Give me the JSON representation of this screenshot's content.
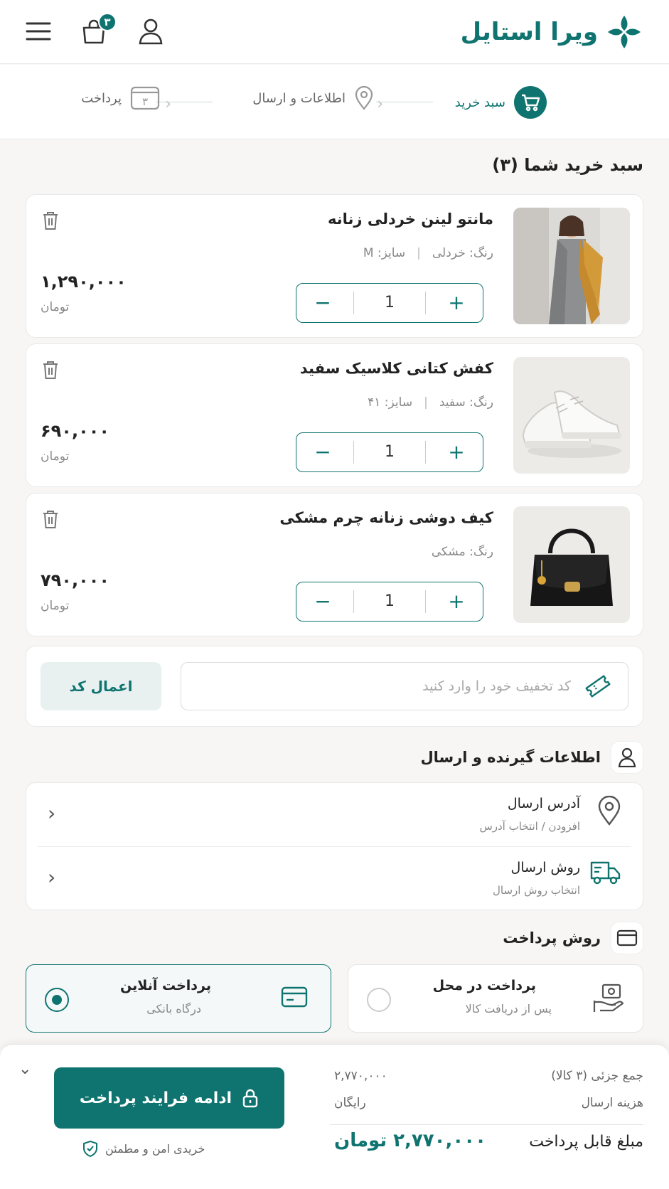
{
  "header": {
    "brand": "ویرا استایل",
    "cart_count": "۳",
    "accent": "#0f7470"
  },
  "steps": [
    {
      "label": "سبد خرید",
      "icon": "cart-icon",
      "state": "active"
    },
    {
      "label": "اطلاعات و ارسال",
      "icon": "location-pin-icon",
      "state": "pending"
    },
    {
      "label": "پرداخت",
      "icon": "payment-card-icon",
      "state": "pending",
      "number": "۳"
    }
  ],
  "cart": {
    "title": "سبد خرید شما (۳)",
    "items": [
      {
        "name": "مانتو لینن خردلی زنانه",
        "color": "رنگ: خردلی",
        "size": "سایز: M",
        "qty": "1",
        "price": "۱,۲۹۰,۰۰۰",
        "currency": "تومان"
      },
      {
        "name": "کفش کتانی کلاسیک سفید",
        "color": "رنگ: سفید",
        "size": "سایز: ۴۱",
        "qty": "1",
        "price": "۶۹۰,۰۰۰",
        "currency": "تومان"
      },
      {
        "name": "کیف دوشی زنانه چرم مشکی",
        "color": "رنگ: مشکی",
        "size": "",
        "qty": "1",
        "price": "۷۹۰,۰۰۰",
        "currency": "تومان"
      }
    ]
  },
  "coupon": {
    "placeholder": "کد تخفیف خود را وارد کنید",
    "apply_label": "اعمال کد"
  },
  "receiver": {
    "title": "اطلاعات گیرنده و ارسال",
    "address_title": "آدرس ارسال",
    "address_sub": "افزودن / انتخاب آدرس",
    "shipping_title": "روش ارسال",
    "shipping_sub": "انتخاب روش ارسال"
  },
  "payment": {
    "title": "روش پرداخت",
    "options": [
      {
        "title": "پرداخت آنلاین",
        "sub": "درگاه بانکی",
        "selected": true
      },
      {
        "title": "پرداخت در محل",
        "sub": "پس از دریافت کالا",
        "selected": false
      }
    ]
  },
  "summary": {
    "subtotal_label": "جمع جزئی (۳ کالا)",
    "subtotal_value": "۲,۷۷۰,۰۰۰",
    "shipping_label": "هزینه ارسال",
    "shipping_value": "رایگان",
    "total_label": "مبلغ قابل پرداخت",
    "total_value": "۲,۷۷۰,۰۰۰ تومان",
    "cta_label": "ادامه فرایند پرداخت",
    "secure_label": "خریدی امن و مطمئن"
  }
}
